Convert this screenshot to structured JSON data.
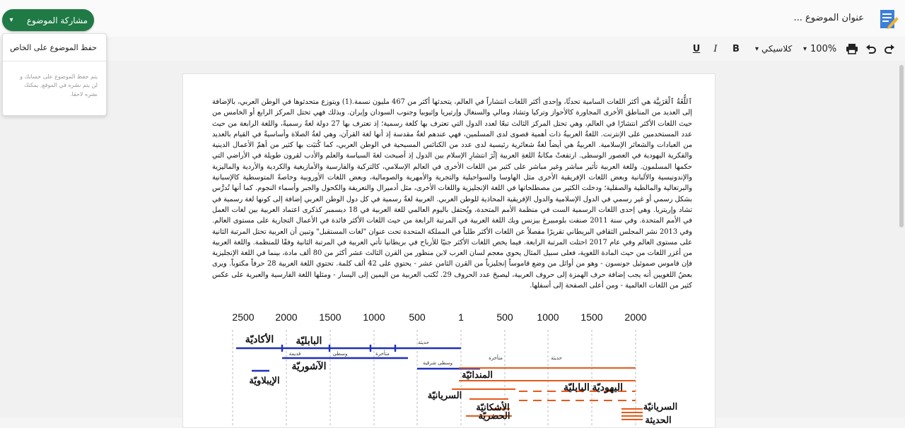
{
  "header": {
    "doc_title": "عنوان الموضوع ...",
    "share_button": "مشاركة الموضوع",
    "share_caret": "▾"
  },
  "share_menu": {
    "save_private": "حفظ الموضوع على الخاص",
    "note": "يتم حفظ الموضوع على حسابك و لن يتم نشره في الموقع, يمكنك نشره لاحقا."
  },
  "toolbar": {
    "style_label": "كلاسيكي",
    "zoom": "100%",
    "bold": "B",
    "italic": "I",
    "underline": "U",
    "caret": "▾"
  },
  "document": {
    "paragraph": "ٱللُّغَةُ ٱلْعَرَبِيَّة هي أكثر اللغات السامية تحدثًا، وإحدى أكثر اللغات انتشاراً في العالم، يتحدثها أكثر من 467 مليون نسمة.(1) ويتوزع متحدثوها في الوطن العربي، بالإضافة إلى العديد من المناطق الأخرى المجاورة كالأحواز وتركيا وتشاد ومالي والسنغال وإرتيريا وإثيوبيا وجنوب السودان وإيران. وبذلك فهي تحتل المركز الرابع أو الخامس من حيث اللغات الأكثر انتشارًا في العالم، وهي تحتل المركز الثالث تبعًا لعدد الدول التي تعترف بها كلغة رسمية؛ إذ تعترف بها 27 دولة لغةً رسميةً، واللغة الرابعة من حيث عدد المستخدمين على الإنترنت. اللغةُ العربيةُ ذات أهمية قصوى لدى المسلمين، فهي عندهم لغةٌ مقدسة إذ أنها لغة القرآن، وهي لغةُ الصلاة وأساسيةٌ في القيام بالعديد من العبادات والشعائر الإسلامية. العربيةُ هي أيضاً لغةٌ شعائرية رئيسية لدى عدد من الكنائس المسيحية في الوطن العربي، كما كُتبَت بها كثير من أهمّ الأعمال الدينية والفكرية اليهودية في العصور الوسطى. ارتفعتْ مكانةُ اللغةِ العربية إثْرَ انتشارِ الإسلام بين الدول إذ أصبحت لغةَ السياسة والعلم والأدب لقرون طويلة في الأراضي التي حكمها المسلمون. وللغة العربية تأثير مباشر وغير مباشر على كثير من اللغات الأخرى في العالم الإسلامي، كالتركية والفارسية والأمازيغية والكردية والأردية والماليزية والإندونيسية والألبانية وبعض اللغات الإفريقية الأخرى مثل الهاوسا والسواحيلية والتجرية والأمهرية والصومالية، وبعض اللغات الأوروبية وخاصةً المتوسطية كالإسبانية والبرتغالية والمالطية والصقلية؛ ودخلت الكثير من مصطلحاتها في اللغة الإنجليزية واللغات الأخرى، مثل أدميرال والتعريفة والكحول والجبر وأسماء النجوم. كما أنها تُدرَّس بشكل رسمي أو غير رسمي في الدول الإسلامية والدول الإفريقية المحاذية للوطن العربي. العربية لغةٌ رسمية في كل دول الوطن العربي إضافة إلى كونها لغة رسمية في تشاد وإريتريا. وهي إحدى اللغات الرسمية الست في منظمة الأمم المتحدة، ويُحتفل باليوم العالمي للغة العربية في 18 ديسمبر كذكرى اعتماد العربية بين لغات العمل في الأمم المتحدة. وفي سنة 2011 صنفت بلومبيرغ بيزنس ويك اللغة العربية في المرتبة الرابعة من حيث اللغات الأكثر فائدة في الأعمال التجارية على مستوى العالم. وفي 2013 نشر المجلس الثقافي البريطاني تقريرًا مفصلاً عن اللغات الأكثر طلباً في المملكة المتحدة تحت عنوان \"لغات المستقبل\" وتبين أن العربية تحتل المرتبة الثانية على مستوى العالم وفي عام 2017 احتلت المرتبة الرابعة. فيما يخص اللغات الأكثر جنيًا للأرباح في بريطانيا تأتي العربية في المرتبة الثانية وفقًا للمنظمة. واللغة العربية من أغزر اللغات من حيث المادة اللغوية، فعلى سبيل المثال يحوي معجم لسان العرب لابن منظور من القرن الثالث عشر أكثر من 80 ألف مادة، بينما في اللغة الإنجليزية فإن قاموس صموئيل جونسون - وهو من أوائل من وضع قاموساً إنجليزياً من القرن الثامن عشر - يحتوي على 42 ألف كلمة. تحتوي اللغة العربية 28 حرفاً مكتوباً. ويرى بعضُ اللغويين أنه يجب إضافة حرف الهمزة إلى حروف العربية، ليصبحَ عدد الحروف 29. تُكتب العربية من اليمين إلى اليسار - ومثلها اللغة الفارسية والعبرية على عكس كثير من اللغات العالمية - ومن أعلى الصفحة إلى أسفلها."
  },
  "figure": {
    "year_ticks": [
      "2500",
      "2000",
      "1500",
      "1000",
      "500",
      "1",
      "500",
      "1000",
      "1500",
      "2000"
    ],
    "languages": {
      "akkadian": "الأكاديّة",
      "babylonian": "البابليّة",
      "assyrian": "الآشوريّة",
      "elamite": "الإيبلاويّة",
      "mandaic": "المندائيّة",
      "syriac": "السريانيّة",
      "ashkhatiya": "الأشكانيّة",
      "hatra": "الحضريّة",
      "jewish_babylonian": "اليهوديّة البابليّة",
      "syriac_right": "السريانيّة",
      "modern_right": "الحديثة"
    },
    "periods": {
      "modern": "حديثة",
      "late": "متأخرة",
      "middle": "وسطى",
      "old": "قديمة",
      "east_middle": "وسطى شرقية"
    },
    "colors": {
      "blue": "#1f2fbf",
      "orange": "#e8591a"
    }
  }
}
